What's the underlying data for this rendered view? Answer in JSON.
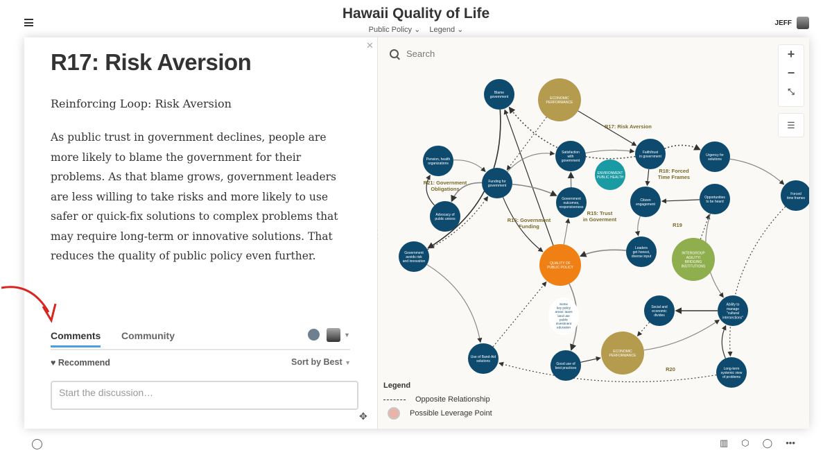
{
  "header": {
    "title": "Hawaii Quality of Life",
    "nav": [
      "Public Policy ⌄",
      "Legend ⌄"
    ],
    "user": "JEFF"
  },
  "article": {
    "title": "R17: Risk Aversion",
    "subtitle": "Reinforcing Loop: Risk Aversion",
    "body": "As public trust in government declines, people are more likely to blame the government for their problems. As that blame grows, government leaders are less willing to take risks and more likely to use safer or quick-fix solutions to complex problems that may require long-term or innovative solutions. That reduces the quality of public policy even further."
  },
  "comments": {
    "tabs": [
      "Comments",
      "Community"
    ],
    "recommend": "Recommend",
    "sort": "Sort by Best",
    "placeholder": "Start the discussion…"
  },
  "map": {
    "search_placeholder": "Search",
    "zoom_in": "+",
    "zoom_out": "−",
    "legend_title": "Legend",
    "legend_items": [
      "Opposite Relationship",
      "Possible Leverage Point"
    ],
    "nodes": [
      {
        "id": "blame",
        "lines": [
          "Blame",
          "government"
        ]
      },
      {
        "id": "econ1",
        "lines": [
          "ECONOMIC",
          "PERFORMANCE"
        ]
      },
      {
        "id": "pension",
        "lines": [
          "Pension, health",
          "organizations"
        ]
      },
      {
        "id": "funding",
        "lines": [
          "Funding for",
          "government"
        ]
      },
      {
        "id": "advocacy",
        "lines": [
          "Advocacy of",
          "public unions"
        ]
      },
      {
        "id": "satisfaction",
        "lines": [
          "Satisfaction",
          "with",
          "government"
        ]
      },
      {
        "id": "envhealth",
        "lines": [
          "ENVIRONMENT",
          "PUBLIC HEALTH"
        ]
      },
      {
        "id": "faith",
        "lines": [
          "Faith/trust",
          "in government"
        ]
      },
      {
        "id": "urgency",
        "lines": [
          "Urgency for",
          "solutions"
        ]
      },
      {
        "id": "forced",
        "lines": [
          "Forced",
          "time frames"
        ]
      },
      {
        "id": "outcomes",
        "lines": [
          "Government",
          "outcomes,",
          "responsiveness"
        ]
      },
      {
        "id": "citizen",
        "lines": [
          "Citizen",
          "engagement"
        ]
      },
      {
        "id": "opportunities",
        "lines": [
          "Opportunities",
          "to be heard"
        ]
      },
      {
        "id": "avoids",
        "lines": [
          "Government",
          "avoids risk",
          "and innovation"
        ]
      },
      {
        "id": "qpp",
        "lines": [
          "QUALITY OF",
          "PUBLIC POLICY"
        ]
      },
      {
        "id": "leaders",
        "lines": [
          "Leaders",
          "get honest,",
          "diverse input"
        ]
      },
      {
        "id": "intergroup",
        "lines": [
          "INTERGROUP",
          "AGILITY/",
          "BRIDGING",
          "INSTITUTIONS"
        ]
      },
      {
        "id": "social",
        "lines": [
          "Social and",
          "economic",
          "divides"
        ]
      },
      {
        "id": "ability",
        "lines": [
          "Ability to",
          "manage",
          "\"cultural",
          "intersections\""
        ]
      },
      {
        "id": "bandaid",
        "lines": [
          "Use of Band-Aid",
          "solutions"
        ]
      },
      {
        "id": "goodpractice",
        "lines": [
          "Good use of",
          "best practices"
        ]
      },
      {
        "id": "econ2",
        "lines": [
          "ECONOMIC",
          "PERFORMANCE"
        ]
      },
      {
        "id": "longterm",
        "lines": [
          "Long-term",
          "systemic view",
          "of problems"
        ]
      },
      {
        "id": "note",
        "lines": [
          "Some",
          "key policy",
          "areas: taxes",
          "land use",
          "public",
          "investment",
          "education"
        ]
      }
    ],
    "loops": [
      "R17: Risk Aversion",
      "R21: Government Obligations",
      "R18: Forced Time Frames",
      "R16: Government Funding",
      "R15: Trust in Goverment",
      "R19",
      "R20"
    ]
  },
  "colors": {
    "node": "#0d4a6e",
    "econ": "#b59b4e",
    "qpp": "#f07f14",
    "env": "#1a9aa3",
    "intergroup": "#8fae4e",
    "loop_label": "#7a6a2a",
    "accent": "#4a9fdc"
  }
}
